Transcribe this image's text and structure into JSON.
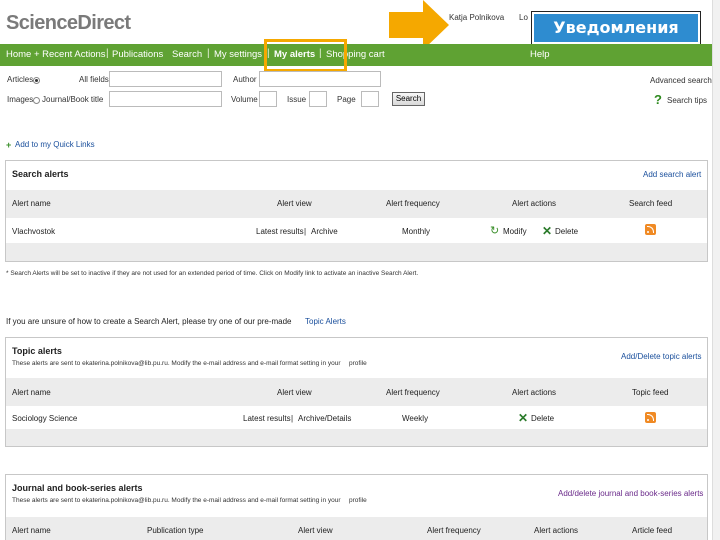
{
  "header": {
    "logo": "ScienceDirect",
    "user_name": "Katja Polnikova",
    "logout": "Lo",
    "notification_banner": "Уведомления"
  },
  "nav": {
    "items": [
      "Home + Recent Actions",
      "Publications",
      "Search",
      "My settings",
      "My alerts",
      "Shopping cart"
    ],
    "help": "Help"
  },
  "search_form": {
    "articles_label": "Articles",
    "images_label": "Images",
    "all_fields_label": "All fields",
    "journal_label": "Journal/Book title",
    "author_label": "Author",
    "volume_label": "Volume",
    "issue_label": "Issue",
    "page_label": "Page",
    "search_button": "Search",
    "advanced_search": "Advanced search",
    "search_tips": "Search tips"
  },
  "quick_links": "Add to my Quick Links",
  "search_alerts": {
    "title": "Search alerts",
    "add_link": "Add search alert",
    "columns": [
      "Alert name",
      "Alert view",
      "Alert frequency",
      "Alert actions",
      "Search feed"
    ],
    "rows": [
      {
        "name": "Vlachvostok",
        "latest": "Latest results",
        "archive": "Archive",
        "frequency": "Monthly",
        "modify": "Modify",
        "delete": "Delete"
      }
    ],
    "note": "* Search Alerts will be set to inactive if they are not used for an extended period of time. Click on Modify link to activate an inactive Search Alert."
  },
  "topic_prompt": {
    "text": "If you are unsure of how to create a Search Alert, please try one of our pre-made",
    "link": "Topic Alerts"
  },
  "topic_alerts": {
    "title": "Topic alerts",
    "sub_text": "These alerts are sent to ekaterina.polnikova@lib.pu.ru. Modify the e-mail address and e-mail format setting in your",
    "sub_link": "profile",
    "add_link": "Add/Delete topic alerts",
    "columns": [
      "Alert name",
      "Alert view",
      "Alert frequency",
      "Alert actions",
      "Topic feed"
    ],
    "rows": [
      {
        "name": "Sociology Science",
        "latest": "Latest results",
        "archive": "Archive/Details",
        "frequency": "Weekly",
        "delete": "Delete"
      }
    ]
  },
  "journal_alerts": {
    "title": "Journal and book-series alerts",
    "sub_text": "These alerts are sent to ekaterina.polnikova@lib.pu.ru. Modify the e-mail address and e-mail format setting in your",
    "sub_link": "profile",
    "add_link": "Add/delete journal and book-series alerts",
    "columns": [
      "Alert name",
      "Publication type",
      "Alert view",
      "Alert frequency",
      "Alert actions",
      "Article feed"
    ]
  },
  "colors": {
    "nav_green": "#5fa233",
    "highlight_orange": "#f5a800",
    "banner_blue": "#2e8cd0",
    "link_blue": "#1a4f9c"
  }
}
